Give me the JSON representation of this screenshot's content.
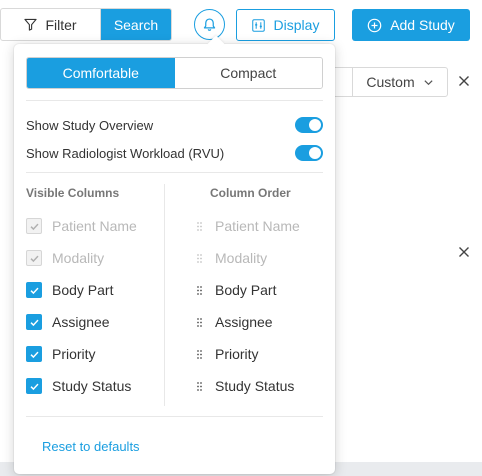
{
  "toolbar": {
    "filter_label": "Filter",
    "search_label": "Search",
    "display_label": "Display",
    "add_study_label": "Add Study"
  },
  "background": {
    "custom_select_value": "Custom"
  },
  "display_popover": {
    "density_options": [
      {
        "label": "Comfortable",
        "selected": true
      },
      {
        "label": "Compact",
        "selected": false
      }
    ],
    "toggles": [
      {
        "label": "Show Study Overview",
        "on": true
      },
      {
        "label": "Show Radiologist Workload (RVU)",
        "on": true
      }
    ],
    "visible_columns_heading": "Visible Columns",
    "column_order_heading": "Column Order",
    "visible_columns": [
      {
        "label": "Patient Name",
        "checked": true,
        "disabled": true
      },
      {
        "label": "Modality",
        "checked": true,
        "disabled": true
      },
      {
        "label": "Body Part",
        "checked": true,
        "disabled": false
      },
      {
        "label": "Assignee",
        "checked": true,
        "disabled": false
      },
      {
        "label": "Priority",
        "checked": true,
        "disabled": false
      },
      {
        "label": "Study Status",
        "checked": true,
        "disabled": false
      }
    ],
    "column_order": [
      {
        "label": "Patient Name",
        "disabled": true
      },
      {
        "label": "Modality",
        "disabled": true
      },
      {
        "label": "Body Part",
        "disabled": false
      },
      {
        "label": "Assignee",
        "disabled": false
      },
      {
        "label": "Priority",
        "disabled": false
      },
      {
        "label": "Study Status",
        "disabled": false
      }
    ],
    "reset_label": "Reset to defaults"
  },
  "colors": {
    "accent": "#1a9ee0",
    "disabled_text": "#b8b8b8"
  }
}
